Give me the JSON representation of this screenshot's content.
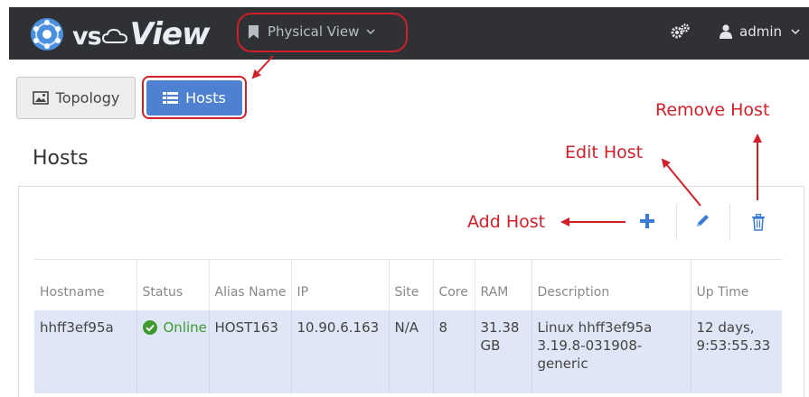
{
  "header": {
    "logo_vs": "vs",
    "logo_view": "View",
    "view_selector": "Physical View",
    "user": "admin"
  },
  "view_toggle": {
    "topology": "Topology",
    "hosts": "Hosts"
  },
  "page_title": "Hosts",
  "annotations": {
    "add_host": "Add Host",
    "edit_host": "Edit Host",
    "remove_host": "Remove Host"
  },
  "table": {
    "columns": [
      "Hostname",
      "Status",
      "Alias Name",
      "IP",
      "Site",
      "Core",
      "RAM",
      "Description",
      "Up Time"
    ],
    "rows": [
      {
        "hostname": "hhff3ef95a",
        "status": "Online",
        "alias": "HOST163",
        "ip": "10.90.6.163",
        "site": "N/A",
        "core": "8",
        "ram": "31.38 GB",
        "description": "Linux hhff3ef95a 3.19.8-031908-generic",
        "uptime": "12 days, 9:53:55.33"
      }
    ]
  },
  "colors": {
    "navbar": "#2f3135",
    "primary_button": "#4f81d1",
    "selected_row": "#dfe7f6",
    "annotation_red": "#d0202a",
    "online_green": "#3c9a2f"
  }
}
